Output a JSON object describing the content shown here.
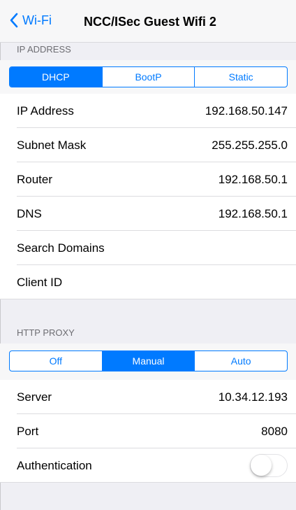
{
  "navbar": {
    "back_label": "Wi-Fi",
    "title": "NCC/ISec Guest Wifi 2"
  },
  "ip_section": {
    "header": "IP ADDRESS",
    "segments": [
      "DHCP",
      "BootP",
      "Static"
    ],
    "selected": "DHCP",
    "rows": [
      {
        "label": "IP Address",
        "value": "192.168.50.147"
      },
      {
        "label": "Subnet Mask",
        "value": "255.255.255.0"
      },
      {
        "label": "Router",
        "value": "192.168.50.1"
      },
      {
        "label": "DNS",
        "value": "192.168.50.1"
      },
      {
        "label": "Search Domains",
        "value": ""
      },
      {
        "label": "Client ID",
        "value": ""
      }
    ]
  },
  "proxy_section": {
    "header": "HTTP PROXY",
    "segments": [
      "Off",
      "Manual",
      "Auto"
    ],
    "selected": "Manual",
    "rows": [
      {
        "label": "Server",
        "value": "10.34.12.193"
      },
      {
        "label": "Port",
        "value": "8080"
      },
      {
        "label": "Authentication",
        "toggle": false
      }
    ]
  },
  "colors": {
    "accent": "#007aff",
    "background": "#efeff4"
  }
}
